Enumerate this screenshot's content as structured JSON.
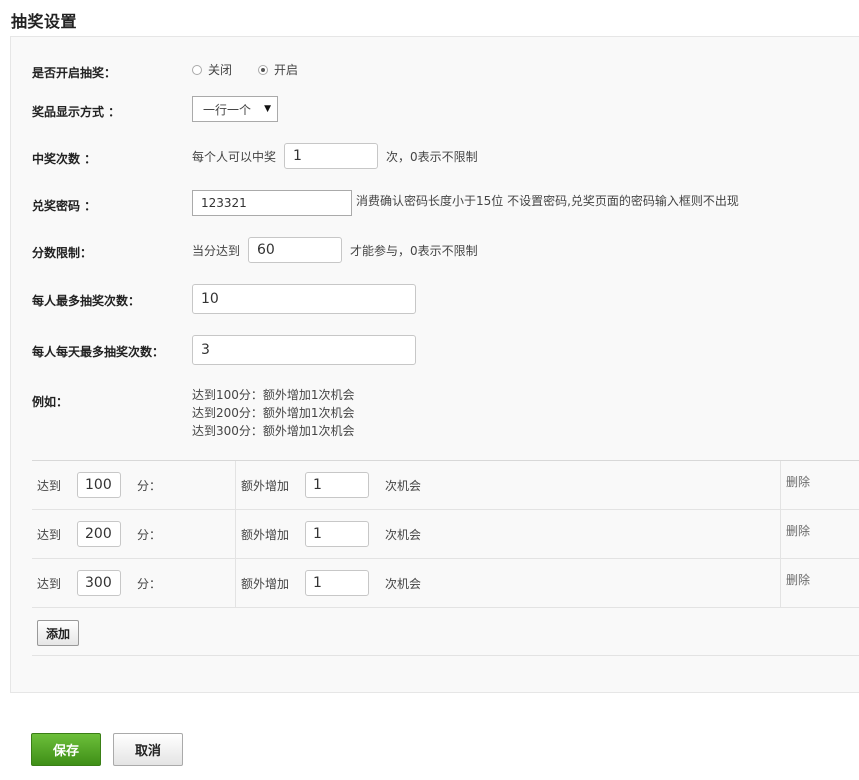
{
  "page": {
    "title": "抽奖设置"
  },
  "form": {
    "lottery_enabled": {
      "label": "是否开启抽奖：",
      "options": [
        "关闭",
        "开启"
      ],
      "selected": "开启"
    },
    "prize_display": {
      "label": "奖品显示方式 ：",
      "value": "一行一个"
    },
    "win_count": {
      "label": "中奖次数 ：",
      "prefix": "每个人可以中奖",
      "value": "1",
      "suffix": "次，0表示不限制"
    },
    "redeem_password": {
      "label": "兑奖密码 ：",
      "value": "123321",
      "hint": "消费确认密码长度小于15位 不设置密码,兑奖页面的密码输入框则不出现"
    },
    "score_limit": {
      "label": "分数限制：",
      "prefix": "当分达到",
      "value": "60",
      "suffix": "才能参与，0表示不限制"
    },
    "max_draws": {
      "label": "每人最多抽奖次数：",
      "value": "10"
    },
    "max_daily_draws": {
      "label": "每人每天最多抽奖次数：",
      "value": "3"
    },
    "example": {
      "label": "例如：",
      "lines": [
        "达到100分：额外增加1次机会",
        "达到200分：额外增加1次机会",
        "达到300分：额外增加1次机会"
      ]
    }
  },
  "rules": {
    "reach_label": "达到",
    "score_unit": "分：",
    "extra_label": "额外增加",
    "chance_unit": "次机会",
    "delete_label": "删除",
    "rows": [
      {
        "score": "100",
        "extra": "1"
      },
      {
        "score": "200",
        "extra": "1"
      },
      {
        "score": "300",
        "extra": "1"
      }
    ],
    "add_label": "添加"
  },
  "actions": {
    "save_label": "保存",
    "cancel_label": "取消"
  },
  "colors": {
    "save_button": "#4fa526",
    "panel_background": "#f9f9f9"
  }
}
